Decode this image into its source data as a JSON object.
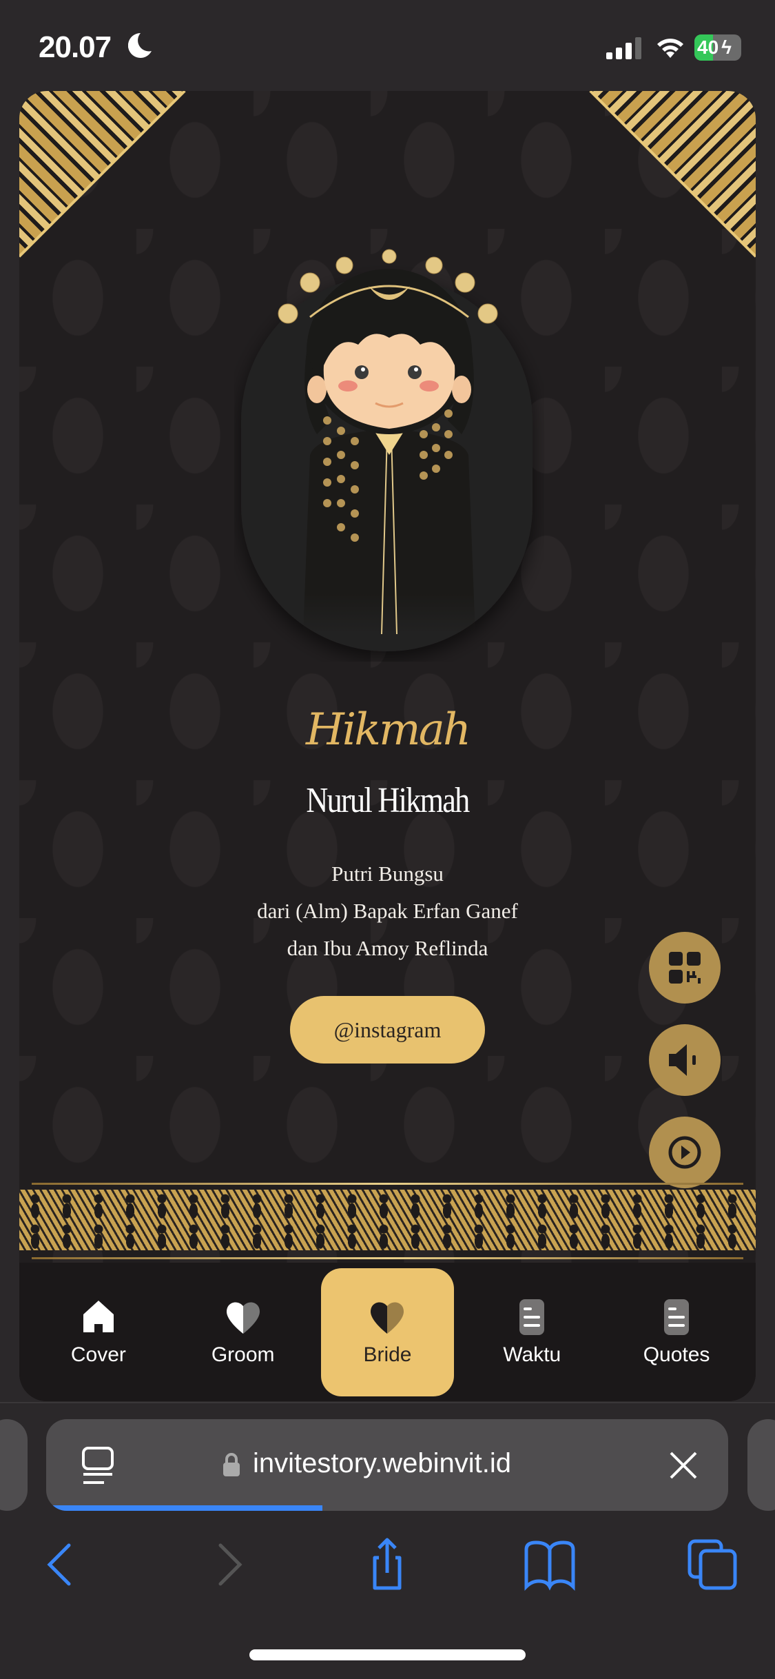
{
  "status_bar": {
    "time": "20.07",
    "battery": "40"
  },
  "invitation": {
    "script_name": "Hikmah",
    "full_name": "Nurul Hikmah",
    "parents": [
      "Putri Bungsu",
      "dari (Alm) Bapak Erfan Ganef",
      "dan Ibu Amoy Reflinda"
    ],
    "instagram_label": "@instagram"
  },
  "nav": {
    "items": [
      {
        "label": "Cover",
        "icon": "home-icon"
      },
      {
        "label": "Groom",
        "icon": "heart-half-icon"
      },
      {
        "label": "Bride",
        "icon": "heart-half-icon",
        "active": true
      },
      {
        "label": "Waktu",
        "icon": "document-icon"
      },
      {
        "label": "Quotes",
        "icon": "document-icon"
      }
    ]
  },
  "browser": {
    "url": "invitestory.webinvit.id",
    "load_progress": 0.4
  },
  "colors": {
    "gold": "#e8c26f",
    "fab": "#b1904f",
    "accent_blue": "#3a86f7"
  }
}
